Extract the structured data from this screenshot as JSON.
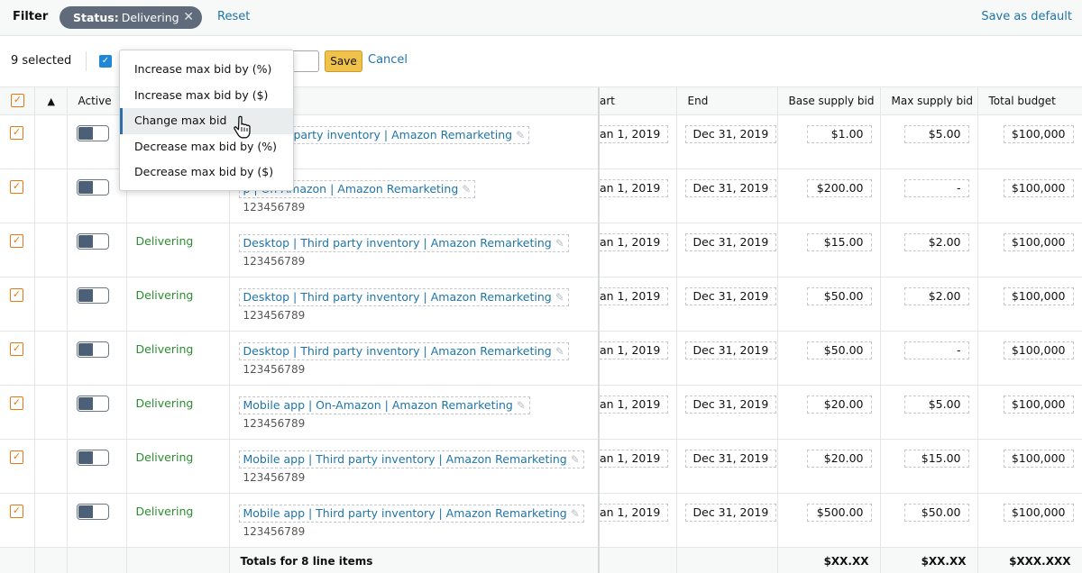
{
  "filter": {
    "label": "Filter",
    "chip_key": "Status:",
    "chip_value": "Delivering",
    "reset": "Reset",
    "save_default": "Save as default"
  },
  "actions": {
    "selected": "9 selected",
    "save": "Save",
    "cancel": "Cancel"
  },
  "dropdown": {
    "items": [
      "Increase max bid by (%)",
      "Increase max bid by ($)",
      "Change max bid",
      "Decrease max bid by (%)",
      "Decrease max bid by ($)"
    ],
    "active_index": 2
  },
  "columns": {
    "active": "Active",
    "start": "art",
    "end": "End",
    "base_bid": "Base supply bid",
    "max_bid": "Max supply bid",
    "budget": "Total budget"
  },
  "rows": [
    {
      "status": "",
      "name": "p | Third party inventory | Amazon Remarketing",
      "id": "9",
      "start": "an 1, 2019",
      "end": "Dec 31, 2019",
      "base": "$1.00",
      "max": "$5.00",
      "budget": "$100,000"
    },
    {
      "status": "",
      "name": "p | On-Amazon | Amazon Remarketing",
      "id": "123456789",
      "start": "an 1, 2019",
      "end": "Dec 31, 2019",
      "base": "$200.00",
      "max": "-",
      "budget": "$100,000"
    },
    {
      "status": "Delivering",
      "name": "Desktop | Third party inventory | Amazon Remarketing",
      "id": "123456789",
      "start": "an 1, 2019",
      "end": "Dec 31, 2019",
      "base": "$15.00",
      "max": "$2.00",
      "budget": "$100,000"
    },
    {
      "status": "Delivering",
      "name": "Desktop | Third party inventory | Amazon Remarketing",
      "id": "123456789",
      "start": "an 1, 2019",
      "end": "Dec 31, 2019",
      "base": "$50.00",
      "max": "$2.00",
      "budget": "$100,000"
    },
    {
      "status": "Delivering",
      "name": "Desktop | Third party inventory | Amazon Remarketing",
      "id": "123456789",
      "start": "an 1, 2019",
      "end": "Dec 31, 2019",
      "base": "$50.00",
      "max": "-",
      "budget": "$100,000"
    },
    {
      "status": "Delivering",
      "name": "Mobile app | On-Amazon | Amazon Remarketing",
      "id": "123456789",
      "start": "an 1, 2019",
      "end": "Dec 31, 2019",
      "base": "$20.00",
      "max": "$5.00",
      "budget": "$100,000"
    },
    {
      "status": "Delivering",
      "name": "Mobile app | Third party inventory | Amazon Remarketing",
      "id": "123456789",
      "start": "an 1, 2019",
      "end": "Dec 31, 2019",
      "base": "$20.00",
      "max": "$15.00",
      "budget": "$100,000"
    },
    {
      "status": "Delivering",
      "name": "Mobile app | Third party inventory | Amazon Remarketing",
      "id": "123456789",
      "start": "an 1, 2019",
      "end": "Dec 31, 2019",
      "base": "$500.00",
      "max": "$50.00",
      "budget": "$100,000"
    }
  ],
  "totals": {
    "label": "Totals for 8 line items",
    "base": "$XX.XX",
    "max": "$XX.XX",
    "budget": "$XXX.XXX"
  },
  "icons": {
    "alert": "warning-triangle-icon",
    "pencil": "pencil-icon",
    "remove": "close-icon",
    "cursor": "hand-pointer-icon"
  }
}
